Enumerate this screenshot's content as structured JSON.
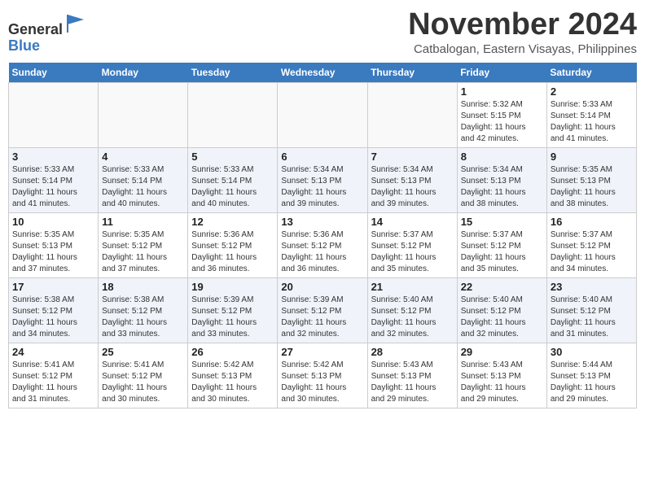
{
  "header": {
    "logo_general": "General",
    "logo_blue": "Blue",
    "month": "November 2024",
    "location": "Catbalogan, Eastern Visayas, Philippines"
  },
  "weekdays": [
    "Sunday",
    "Monday",
    "Tuesday",
    "Wednesday",
    "Thursday",
    "Friday",
    "Saturday"
  ],
  "weeks": [
    [
      {
        "day": "",
        "info": ""
      },
      {
        "day": "",
        "info": ""
      },
      {
        "day": "",
        "info": ""
      },
      {
        "day": "",
        "info": ""
      },
      {
        "day": "",
        "info": ""
      },
      {
        "day": "1",
        "info": "Sunrise: 5:32 AM\nSunset: 5:15 PM\nDaylight: 11 hours\nand 42 minutes."
      },
      {
        "day": "2",
        "info": "Sunrise: 5:33 AM\nSunset: 5:14 PM\nDaylight: 11 hours\nand 41 minutes."
      }
    ],
    [
      {
        "day": "3",
        "info": "Sunrise: 5:33 AM\nSunset: 5:14 PM\nDaylight: 11 hours\nand 41 minutes."
      },
      {
        "day": "4",
        "info": "Sunrise: 5:33 AM\nSunset: 5:14 PM\nDaylight: 11 hours\nand 40 minutes."
      },
      {
        "day": "5",
        "info": "Sunrise: 5:33 AM\nSunset: 5:14 PM\nDaylight: 11 hours\nand 40 minutes."
      },
      {
        "day": "6",
        "info": "Sunrise: 5:34 AM\nSunset: 5:13 PM\nDaylight: 11 hours\nand 39 minutes."
      },
      {
        "day": "7",
        "info": "Sunrise: 5:34 AM\nSunset: 5:13 PM\nDaylight: 11 hours\nand 39 minutes."
      },
      {
        "day": "8",
        "info": "Sunrise: 5:34 AM\nSunset: 5:13 PM\nDaylight: 11 hours\nand 38 minutes."
      },
      {
        "day": "9",
        "info": "Sunrise: 5:35 AM\nSunset: 5:13 PM\nDaylight: 11 hours\nand 38 minutes."
      }
    ],
    [
      {
        "day": "10",
        "info": "Sunrise: 5:35 AM\nSunset: 5:13 PM\nDaylight: 11 hours\nand 37 minutes."
      },
      {
        "day": "11",
        "info": "Sunrise: 5:35 AM\nSunset: 5:12 PM\nDaylight: 11 hours\nand 37 minutes."
      },
      {
        "day": "12",
        "info": "Sunrise: 5:36 AM\nSunset: 5:12 PM\nDaylight: 11 hours\nand 36 minutes."
      },
      {
        "day": "13",
        "info": "Sunrise: 5:36 AM\nSunset: 5:12 PM\nDaylight: 11 hours\nand 36 minutes."
      },
      {
        "day": "14",
        "info": "Sunrise: 5:37 AM\nSunset: 5:12 PM\nDaylight: 11 hours\nand 35 minutes."
      },
      {
        "day": "15",
        "info": "Sunrise: 5:37 AM\nSunset: 5:12 PM\nDaylight: 11 hours\nand 35 minutes."
      },
      {
        "day": "16",
        "info": "Sunrise: 5:37 AM\nSunset: 5:12 PM\nDaylight: 11 hours\nand 34 minutes."
      }
    ],
    [
      {
        "day": "17",
        "info": "Sunrise: 5:38 AM\nSunset: 5:12 PM\nDaylight: 11 hours\nand 34 minutes."
      },
      {
        "day": "18",
        "info": "Sunrise: 5:38 AM\nSunset: 5:12 PM\nDaylight: 11 hours\nand 33 minutes."
      },
      {
        "day": "19",
        "info": "Sunrise: 5:39 AM\nSunset: 5:12 PM\nDaylight: 11 hours\nand 33 minutes."
      },
      {
        "day": "20",
        "info": "Sunrise: 5:39 AM\nSunset: 5:12 PM\nDaylight: 11 hours\nand 32 minutes."
      },
      {
        "day": "21",
        "info": "Sunrise: 5:40 AM\nSunset: 5:12 PM\nDaylight: 11 hours\nand 32 minutes."
      },
      {
        "day": "22",
        "info": "Sunrise: 5:40 AM\nSunset: 5:12 PM\nDaylight: 11 hours\nand 32 minutes."
      },
      {
        "day": "23",
        "info": "Sunrise: 5:40 AM\nSunset: 5:12 PM\nDaylight: 11 hours\nand 31 minutes."
      }
    ],
    [
      {
        "day": "24",
        "info": "Sunrise: 5:41 AM\nSunset: 5:12 PM\nDaylight: 11 hours\nand 31 minutes."
      },
      {
        "day": "25",
        "info": "Sunrise: 5:41 AM\nSunset: 5:12 PM\nDaylight: 11 hours\nand 30 minutes."
      },
      {
        "day": "26",
        "info": "Sunrise: 5:42 AM\nSunset: 5:13 PM\nDaylight: 11 hours\nand 30 minutes."
      },
      {
        "day": "27",
        "info": "Sunrise: 5:42 AM\nSunset: 5:13 PM\nDaylight: 11 hours\nand 30 minutes."
      },
      {
        "day": "28",
        "info": "Sunrise: 5:43 AM\nSunset: 5:13 PM\nDaylight: 11 hours\nand 29 minutes."
      },
      {
        "day": "29",
        "info": "Sunrise: 5:43 AM\nSunset: 5:13 PM\nDaylight: 11 hours\nand 29 minutes."
      },
      {
        "day": "30",
        "info": "Sunrise: 5:44 AM\nSunset: 5:13 PM\nDaylight: 11 hours\nand 29 minutes."
      }
    ]
  ]
}
